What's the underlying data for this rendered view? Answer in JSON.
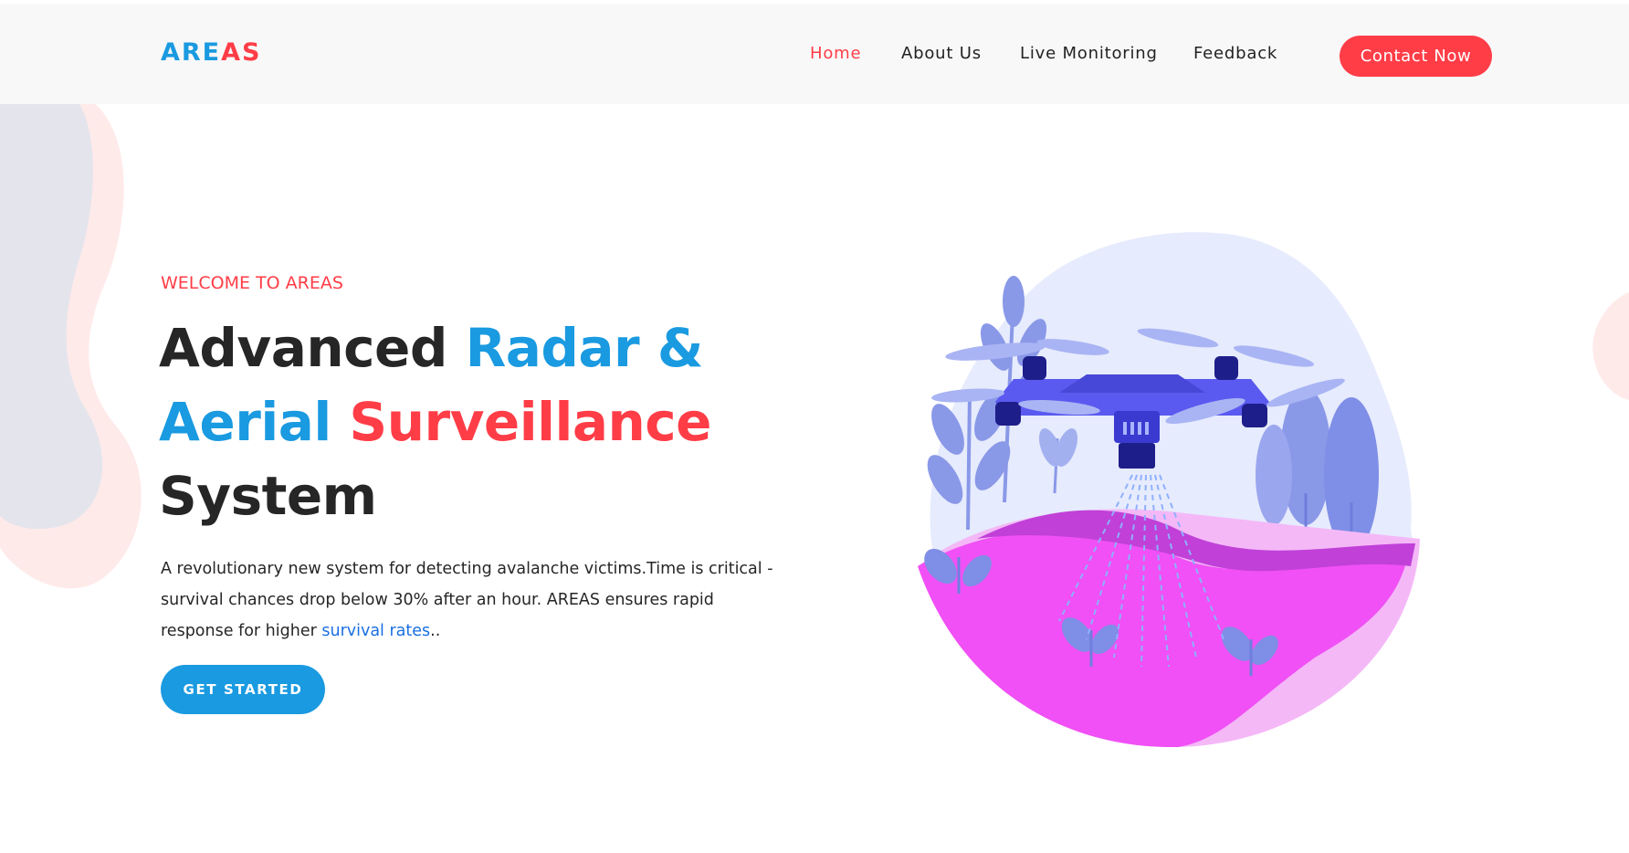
{
  "brand": {
    "part1": "ARE",
    "part2": "AS"
  },
  "nav": {
    "items": [
      {
        "label": "Home",
        "active": true
      },
      {
        "label": "About Us",
        "active": false
      },
      {
        "label": "Live Monitoring",
        "active": false
      },
      {
        "label": "Feedback",
        "active": false
      }
    ],
    "contact_label": "Contact Now"
  },
  "hero": {
    "eyebrow": "WELCOME TO AREAS",
    "headline": {
      "w1": "Advanced ",
      "w2": "Radar &",
      "w3": "Aerial ",
      "w4": "Surveillance",
      "w5": "System"
    },
    "description": {
      "text": "A revolutionary new system for detecting avalanche victims.Time is critical - survival chances drop below 30% after an hour. AREAS ensures rapid response for higher ",
      "link": "survival rates",
      "suffix": ".."
    },
    "cta_label": "GET STARTED",
    "illustration_icon": "drone-illustration-icon"
  },
  "colors": {
    "accent_red": "#ff3d47",
    "accent_blue": "#1a9ae0",
    "header_bg": "#f8f8f8"
  }
}
